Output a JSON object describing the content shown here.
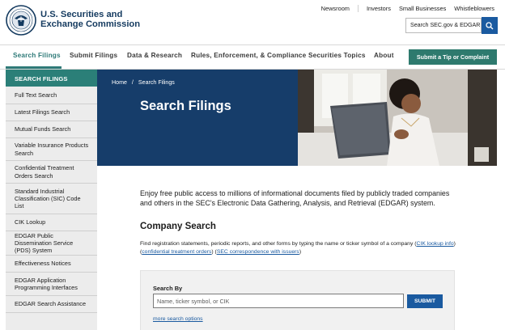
{
  "header": {
    "agency_name_line1": "U.S. Securities and",
    "agency_name_line2": "Exchange Commission",
    "utility_links": [
      "Newsroom",
      "Investors",
      "Small Businesses",
      "Whistleblowers"
    ],
    "search_placeholder": "Search SEC.gov & EDGAR"
  },
  "nav": {
    "items": [
      "Search Filings",
      "Submit Filings",
      "Data & Research",
      "Rules, Enforcement, & Compliance",
      "Securities Topics",
      "About"
    ],
    "tip_button": "Submit a Tip or Complaint"
  },
  "sidebar": {
    "heading": "SEARCH FILINGS",
    "items": [
      "Full Text Search",
      "Latest Filings Search",
      "Mutual Funds Search",
      "Variable Insurance Products Search",
      "Confidential Treatment Orders Search",
      "Standard Industrial Classification (SIC) Code List",
      "CIK Lookup",
      "EDGAR Public Dissemination Service (PDS) System",
      "Effectiveness Notices",
      "EDGAR Application Programming Interfaces",
      "EDGAR Search Assistance"
    ]
  },
  "hero": {
    "breadcrumb_home": "Home",
    "breadcrumb_sep": "/",
    "breadcrumb_current": "Search Filings",
    "title": "Search Filings"
  },
  "content": {
    "intro": "Enjoy free public access to millions of informational documents filed by publicly traded companies and others in the SEC's Electronic Data Gathering, Analysis, and Retrieval (EDGAR) system.",
    "company_heading": "Company Search",
    "desc_text": "Find registration statements, periodic reports, and other forms by typing the name or ticker symbol of a company",
    "link_cik": "CIK lookup info",
    "link_cto": "confidential treatment orders",
    "link_corr": "SEC correspondence with issuers",
    "search_by_label": "Search By",
    "input_placeholder": "Name, ticker symbol, or CIK",
    "submit_label": "SUBMIT",
    "more_options": "more search options"
  },
  "colors": {
    "navy": "#163d6a",
    "teal": "#2b7f78",
    "link_blue": "#1a5aa0"
  }
}
